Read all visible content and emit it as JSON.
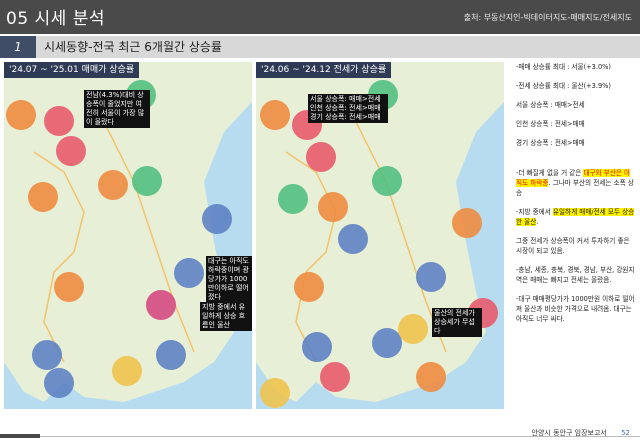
{
  "header": {
    "title": "05 시세 분석",
    "source": "출처: 부동산지인-빅데이터지도-매매지도/전세지도"
  },
  "section": {
    "number": "1",
    "label": "시세동향-전국 최근 6개월간 상승률"
  },
  "left_map": {
    "title": "'24.07 ~ '25.01 매매가 상승률",
    "notes": [
      "전남(4.3%)대비 상승폭이 줄었지만 여전히 서울이 가장 많이 올랐다",
      "대구는 아직도 하락중이며 광당가가 1000만이하로 떨어졌다",
      "지방 중에서 유일하게 상승 흐름인 울산"
    ]
  },
  "right_map": {
    "title": "'24.06 ~ '24.12 전세가 상승률",
    "notes": [
      "서울 상승폭: 매매>전세",
      "인천 상승폭: 전세>매매",
      "경기 상승폭: 전세>매매",
      "울산의 전세가 상승세가 무섭다"
    ]
  },
  "sidebar": {
    "lines": [
      "-매매 상승률 최대 : 서울(+3.0%)",
      "-전세 상승률 최대 : 울산(+3.9%)",
      "서울 상승폭 : 매매>전세",
      "인천 상승폭 : 전세>매매",
      "경기 상승폭 : 전세>매매"
    ],
    "para1_pre": "-더 빠질게 없을 거 같은 ",
    "para1_hl": "대구와 부산은 아직도 하락중",
    "para1_post": ". 그나마 부산의 전세는 소폭 상승",
    "para2_pre": "-지방 중에서 ",
    "para2_hl": "유일하게 매매/전세 모두 상승한 울산",
    "para2_post": ".",
    "para3": "그중 전세가 상승폭이 커서 투자하기 좋은 시장이 되고 있음.",
    "para4": "-충남, 세종, 충북, 경북, 경남, 부산, 강원지역은 매매는 빠지고 전세는 올랐음.",
    "para5": "-대구 매매평당가가 1000만원 이하로 떨어져 울산과 비슷한 가격으로 내려옴. 대구는 아직도 너무 싸다."
  },
  "footer": {
    "text": "안양시 동안구 임장보고서",
    "page": "52"
  },
  "colors": {
    "header_bg": "#4a4a4a",
    "section_num_bg": "#3f4d66",
    "map_title_bg": "#2f3b55",
    "highlight": "#fff200"
  }
}
